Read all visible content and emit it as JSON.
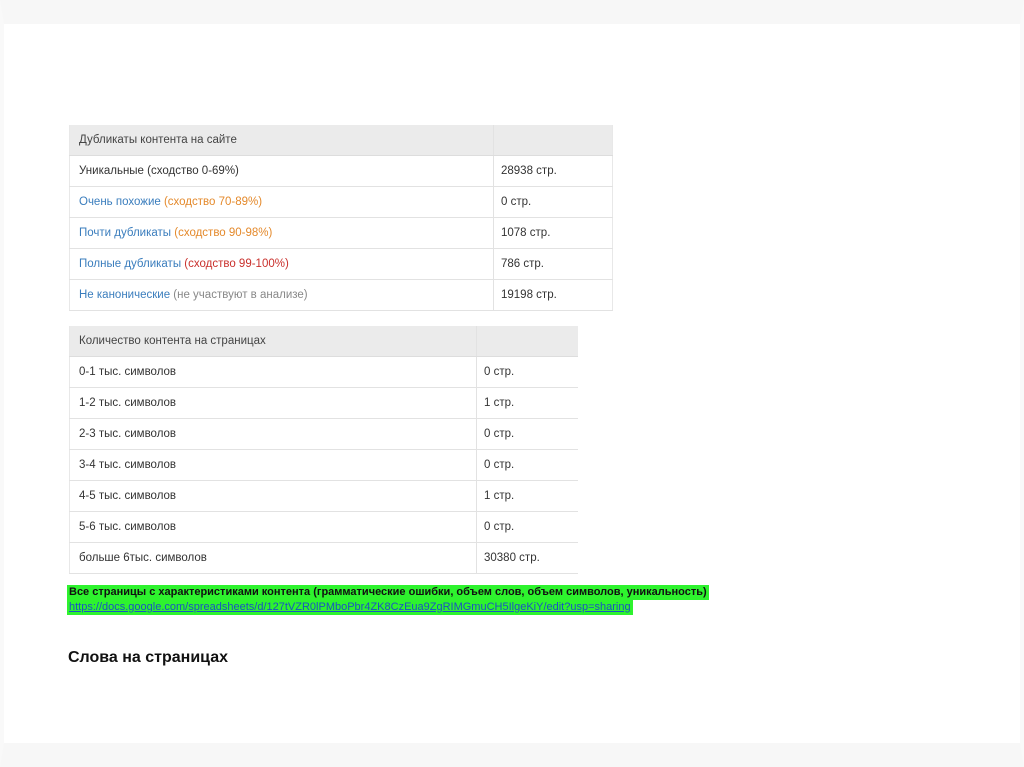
{
  "duplicates_table": {
    "header": "Дубликаты контента на сайте",
    "header_value": "",
    "rows": [
      {
        "main": "Уникальные",
        "note": " (сходство 0-69%)",
        "value": "28938 стр."
      },
      {
        "main": "Очень похожие",
        "note": " (сходство 70-89%)",
        "value": "0 стр."
      },
      {
        "main": "Почти дубликаты",
        "note": " (сходство 90-98%)",
        "value": "1078 стр."
      },
      {
        "main": "Полные дубликаты",
        "note": " (сходство 99-100%)",
        "value": "786 стр."
      },
      {
        "main": "Не канонические",
        "note": " (не участвуют в анализе)",
        "value": "19198 стр."
      }
    ]
  },
  "content_length_table": {
    "header": "Количество контента на страницах",
    "header_value": "",
    "rows": [
      {
        "label": "0-1 тыс. символов",
        "value": "0 стр."
      },
      {
        "label": "1-2 тыс. символов",
        "value": "1 стр."
      },
      {
        "label": "2-3 тыс. символов",
        "value": "0 стр."
      },
      {
        "label": "3-4 тыс. символов",
        "value": "0 стр."
      },
      {
        "label": "4-5 тыс. символов",
        "value": "1 стр."
      },
      {
        "label": "5-6 тыс. символов",
        "value": "0 стр."
      },
      {
        "label": "больше 6тыс. символов",
        "value": "30380 стр."
      }
    ]
  },
  "note": {
    "text": "Все страницы с характеристиками контента (грамматические ошибки, объем слов, объем символов, уникальность)",
    "link": "https://docs.google.com/spreadsheets/d/127tVZR0lPMboPbr4ZK8CzEua9ZgRIMGmuCH5IlgeKiY/edit?usp=sharing",
    "highlight_color": "#2ef32e"
  },
  "section_heading": "Слова на страницах",
  "colors": {
    "unique": "#333333",
    "very_similar_note": "#e4892b",
    "almost_dup_note": "#e4892b",
    "full_dup_note": "#c9302c",
    "label_blue": "#3a7dbd",
    "non_canonical_note": "#888888"
  }
}
